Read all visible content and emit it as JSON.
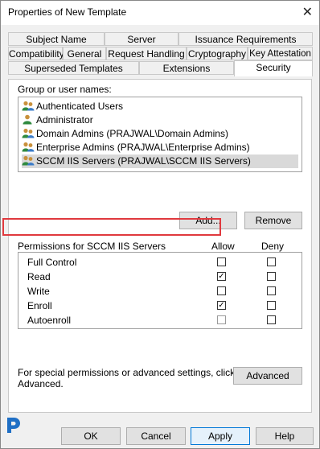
{
  "window": {
    "title": "Properties of New Template",
    "close_glyph": "✕"
  },
  "tabs": {
    "row1": [
      "Subject Name",
      "Server",
      "Issuance Requirements"
    ],
    "row2": [
      "Compatibility",
      "General",
      "Request Handling",
      "Cryptography",
      "Key Attestation"
    ],
    "row3": [
      "Superseded Templates",
      "Extensions",
      "Security"
    ],
    "active": "Security"
  },
  "security": {
    "group_label": "Group or user names:",
    "users": [
      "Authenticated Users",
      "Administrator",
      "Domain Admins (PRAJWAL\\Domain Admins)",
      "Enterprise Admins (PRAJWAL\\Enterprise Admins)",
      "SCCM IIS Servers (PRAJWAL\\SCCM IIS Servers)"
    ],
    "selected_user": "SCCM IIS Servers (PRAJWAL\\SCCM IIS Servers)",
    "add_label": "Add...",
    "remove_label": "Remove",
    "permissions_label": "Permissions for SCCM IIS Servers",
    "allow_label": "Allow",
    "deny_label": "Deny",
    "permissions": [
      {
        "name": "Full Control",
        "allow": false,
        "deny": false
      },
      {
        "name": "Read",
        "allow": true,
        "deny": false
      },
      {
        "name": "Write",
        "allow": false,
        "deny": false
      },
      {
        "name": "Enroll",
        "allow": true,
        "deny": false
      },
      {
        "name": "Autoenroll",
        "allow": false,
        "deny": false
      }
    ],
    "special_text_1": "For special permissions or advanced settings, click",
    "special_text_2": "Advanced.",
    "advanced_label": "Advanced"
  },
  "footer": {
    "ok": "OK",
    "cancel": "Cancel",
    "apply": "Apply",
    "help": "Help"
  },
  "colors": {
    "highlight": "#e0393e",
    "logo": "#1f6fc5",
    "primary_border": "#0078d7"
  }
}
